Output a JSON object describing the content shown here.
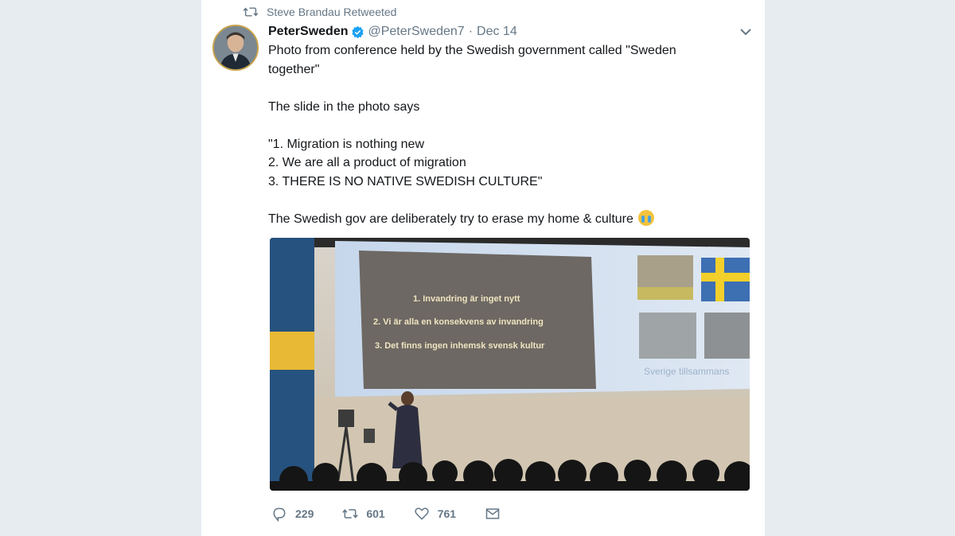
{
  "retweet": {
    "label": "Steve Brandau Retweeted"
  },
  "tweet": {
    "author_name": "PeterSweden",
    "handle": "@PeterSweden7",
    "separator": "·",
    "date": "Dec 14",
    "text": "Photo from conference held by the Swedish government called \"Sweden\ntogether\"\n\nThe slide in the photo says\n\n\"1. Migration is nothing new\n2. We are all a product of migration\n3. THERE IS NO NATIVE SWEDISH CULTURE\"\n\nThe Swedish gov are deliberately try to erase my home & culture"
  },
  "photo": {
    "slide_lines": [
      "1.   Invandring är inget nytt",
      "2. Vi är alla en konsekvens av invandring",
      "3. Det finns ingen inhemsk svensk kultur"
    ],
    "slide_caption": "Sverige tillsammans"
  },
  "actions": {
    "replies": "229",
    "retweets": "601",
    "likes": "761"
  },
  "icons": {
    "retweet": "retweet-icon",
    "verified": "verified-badge-icon",
    "caret": "chevron-down-icon",
    "reply": "reply-icon",
    "like": "heart-icon",
    "message": "envelope-icon",
    "emoji": "crying-face-emoji"
  },
  "colors": {
    "background": "#e6ecf0",
    "card": "#ffffff",
    "secondary_text": "#657786",
    "verified_blue": "#1da1f2"
  }
}
